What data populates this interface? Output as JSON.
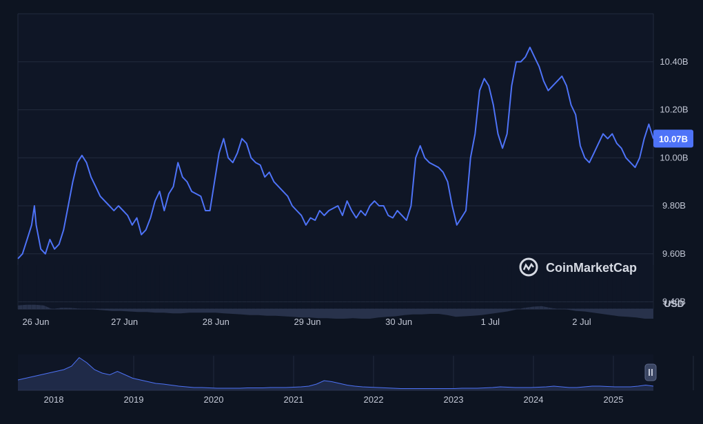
{
  "chart_data": {
    "type": "line",
    "title": "",
    "xlabel": "",
    "ylabel": "",
    "unit": "USD",
    "ylim": [
      9.37,
      10.6
    ],
    "y_ticks": [
      {
        "value": 9.4,
        "label": "9.40B"
      },
      {
        "value": 9.6,
        "label": "9.60B"
      },
      {
        "value": 9.8,
        "label": "9.80B"
      },
      {
        "value": 10.0,
        "label": "10.00B"
      },
      {
        "value": 10.2,
        "label": "10.20B"
      },
      {
        "value": 10.4,
        "label": "10.40B"
      }
    ],
    "x_range": [
      0,
      6.95
    ],
    "x_ticks": [
      {
        "value": 0.03,
        "label": "26 Jun"
      },
      {
        "value": 1.0,
        "label": "27 Jun"
      },
      {
        "value": 2.0,
        "label": "28 Jun"
      },
      {
        "value": 3.0,
        "label": "29 Jun"
      },
      {
        "value": 4.0,
        "label": "30 Jun"
      },
      {
        "value": 5.0,
        "label": "1 Jul"
      },
      {
        "value": 6.0,
        "label": "2 Jul"
      }
    ],
    "current_value_label": "10.07B",
    "grid": true,
    "line_color": "#4e73f8",
    "volume_color": "#2b3550",
    "series": [
      {
        "values": [
          [
            0.0,
            9.58
          ],
          [
            0.05,
            9.6
          ],
          [
            0.1,
            9.66
          ],
          [
            0.15,
            9.72
          ],
          [
            0.18,
            9.8
          ],
          [
            0.2,
            9.72
          ],
          [
            0.25,
            9.62
          ],
          [
            0.3,
            9.6
          ],
          [
            0.35,
            9.66
          ],
          [
            0.4,
            9.62
          ],
          [
            0.45,
            9.64
          ],
          [
            0.5,
            9.7
          ],
          [
            0.55,
            9.8
          ],
          [
            0.6,
            9.9
          ],
          [
            0.65,
            9.98
          ],
          [
            0.7,
            10.01
          ],
          [
            0.75,
            9.98
          ],
          [
            0.8,
            9.92
          ],
          [
            0.85,
            9.88
          ],
          [
            0.9,
            9.84
          ],
          [
            0.95,
            9.82
          ],
          [
            1.0,
            9.8
          ],
          [
            1.05,
            9.78
          ],
          [
            1.1,
            9.8
          ],
          [
            1.15,
            9.78
          ],
          [
            1.2,
            9.76
          ],
          [
            1.25,
            9.72
          ],
          [
            1.3,
            9.75
          ],
          [
            1.35,
            9.68
          ],
          [
            1.4,
            9.7
          ],
          [
            1.45,
            9.75
          ],
          [
            1.5,
            9.82
          ],
          [
            1.55,
            9.86
          ],
          [
            1.6,
            9.78
          ],
          [
            1.65,
            9.85
          ],
          [
            1.7,
            9.88
          ],
          [
            1.75,
            9.98
          ],
          [
            1.8,
            9.92
          ],
          [
            1.85,
            9.9
          ],
          [
            1.9,
            9.86
          ],
          [
            1.95,
            9.85
          ],
          [
            2.0,
            9.84
          ],
          [
            2.05,
            9.78
          ],
          [
            2.1,
            9.78
          ],
          [
            2.15,
            9.9
          ],
          [
            2.2,
            10.02
          ],
          [
            2.25,
            10.08
          ],
          [
            2.3,
            10.0
          ],
          [
            2.35,
            9.98
          ],
          [
            2.4,
            10.02
          ],
          [
            2.45,
            10.08
          ],
          [
            2.5,
            10.06
          ],
          [
            2.55,
            10.0
          ],
          [
            2.6,
            9.98
          ],
          [
            2.65,
            9.97
          ],
          [
            2.7,
            9.92
          ],
          [
            2.75,
            9.94
          ],
          [
            2.8,
            9.9
          ],
          [
            2.85,
            9.88
          ],
          [
            2.9,
            9.86
          ],
          [
            2.95,
            9.84
          ],
          [
            3.0,
            9.8
          ],
          [
            3.05,
            9.78
          ],
          [
            3.1,
            9.76
          ],
          [
            3.15,
            9.72
          ],
          [
            3.2,
            9.75
          ],
          [
            3.25,
            9.74
          ],
          [
            3.3,
            9.78
          ],
          [
            3.35,
            9.76
          ],
          [
            3.4,
            9.78
          ],
          [
            3.45,
            9.79
          ],
          [
            3.5,
            9.8
          ],
          [
            3.55,
            9.76
          ],
          [
            3.6,
            9.82
          ],
          [
            3.65,
            9.78
          ],
          [
            3.7,
            9.75
          ],
          [
            3.75,
            9.78
          ],
          [
            3.8,
            9.76
          ],
          [
            3.85,
            9.8
          ],
          [
            3.9,
            9.82
          ],
          [
            3.95,
            9.8
          ],
          [
            4.0,
            9.8
          ],
          [
            4.05,
            9.76
          ],
          [
            4.1,
            9.75
          ],
          [
            4.15,
            9.78
          ],
          [
            4.2,
            9.76
          ],
          [
            4.25,
            9.74
          ],
          [
            4.3,
            9.8
          ],
          [
            4.35,
            10.0
          ],
          [
            4.4,
            10.05
          ],
          [
            4.45,
            10.0
          ],
          [
            4.5,
            9.98
          ],
          [
            4.55,
            9.97
          ],
          [
            4.6,
            9.96
          ],
          [
            4.65,
            9.94
          ],
          [
            4.7,
            9.9
          ],
          [
            4.75,
            9.8
          ],
          [
            4.8,
            9.72
          ],
          [
            4.85,
            9.75
          ],
          [
            4.9,
            9.78
          ],
          [
            4.95,
            10.0
          ],
          [
            5.0,
            10.1
          ],
          [
            5.05,
            10.28
          ],
          [
            5.1,
            10.33
          ],
          [
            5.15,
            10.3
          ],
          [
            5.2,
            10.22
          ],
          [
            5.25,
            10.1
          ],
          [
            5.3,
            10.04
          ],
          [
            5.35,
            10.1
          ],
          [
            5.4,
            10.3
          ],
          [
            5.45,
            10.4
          ],
          [
            5.5,
            10.4
          ],
          [
            5.55,
            10.42
          ],
          [
            5.6,
            10.46
          ],
          [
            5.65,
            10.42
          ],
          [
            5.7,
            10.38
          ],
          [
            5.75,
            10.32
          ],
          [
            5.8,
            10.28
          ],
          [
            5.85,
            10.3
          ],
          [
            5.9,
            10.32
          ],
          [
            5.95,
            10.34
          ],
          [
            6.0,
            10.3
          ],
          [
            6.05,
            10.22
          ],
          [
            6.1,
            10.18
          ],
          [
            6.15,
            10.05
          ],
          [
            6.2,
            10.0
          ],
          [
            6.25,
            9.98
          ],
          [
            6.3,
            10.02
          ],
          [
            6.35,
            10.06
          ],
          [
            6.4,
            10.1
          ],
          [
            6.45,
            10.08
          ],
          [
            6.5,
            10.1
          ],
          [
            6.55,
            10.06
          ],
          [
            6.6,
            10.04
          ],
          [
            6.65,
            10.0
          ],
          [
            6.7,
            9.98
          ],
          [
            6.75,
            9.96
          ],
          [
            6.8,
            10.0
          ],
          [
            6.85,
            10.08
          ],
          [
            6.9,
            10.14
          ],
          [
            6.95,
            10.08
          ]
        ]
      }
    ],
    "volume": [
      9.385,
      9.388,
      9.388,
      9.385,
      9.37,
      9.375,
      9.375,
      9.372,
      9.37,
      9.368,
      9.365,
      9.362,
      9.362,
      9.36,
      9.358,
      9.358,
      9.355,
      9.355,
      9.352,
      9.352,
      9.355,
      9.355,
      9.355,
      9.355,
      9.352,
      9.35,
      9.348,
      9.345,
      9.345,
      9.342,
      9.342,
      9.34,
      9.338,
      9.335,
      9.335,
      9.332,
      9.332,
      9.33,
      9.33,
      9.332,
      9.33,
      9.33,
      9.335,
      9.338,
      9.34,
      9.345,
      9.348,
      9.348,
      9.35,
      9.35,
      9.345,
      9.338,
      9.34,
      9.342,
      9.345,
      9.35,
      9.355,
      9.36,
      9.368,
      9.375,
      9.38,
      9.382,
      9.375,
      9.37,
      9.368,
      9.362,
      9.36,
      9.355,
      9.35,
      9.345,
      9.34,
      9.338,
      9.335,
      9.33,
      9.33
    ],
    "navigator": {
      "year_ticks": [
        "2018",
        "2019",
        "2020",
        "2021",
        "2022",
        "2023",
        "2024",
        "2025"
      ],
      "values": [
        0.3,
        0.35,
        0.4,
        0.45,
        0.5,
        0.55,
        0.6,
        0.7,
        0.95,
        0.8,
        0.6,
        0.5,
        0.45,
        0.55,
        0.45,
        0.35,
        0.3,
        0.25,
        0.2,
        0.18,
        0.15,
        0.12,
        0.1,
        0.08,
        0.08,
        0.07,
        0.06,
        0.06,
        0.06,
        0.06,
        0.07,
        0.07,
        0.07,
        0.08,
        0.08,
        0.08,
        0.09,
        0.1,
        0.12,
        0.18,
        0.28,
        0.25,
        0.2,
        0.15,
        0.12,
        0.1,
        0.09,
        0.08,
        0.07,
        0.06,
        0.05,
        0.05,
        0.05,
        0.05,
        0.05,
        0.05,
        0.05,
        0.05,
        0.06,
        0.06,
        0.06,
        0.07,
        0.08,
        0.1,
        0.09,
        0.08,
        0.08,
        0.08,
        0.09,
        0.1,
        0.12,
        0.1,
        0.08,
        0.08,
        0.1,
        0.12,
        0.12,
        0.11,
        0.1,
        0.1,
        0.1,
        0.12,
        0.15,
        0.12
      ],
      "handle_icon": "pause-icon"
    }
  },
  "brand": {
    "name": "CoinMarketCap",
    "logo_icon": "coinmarketcap-logo-icon"
  }
}
